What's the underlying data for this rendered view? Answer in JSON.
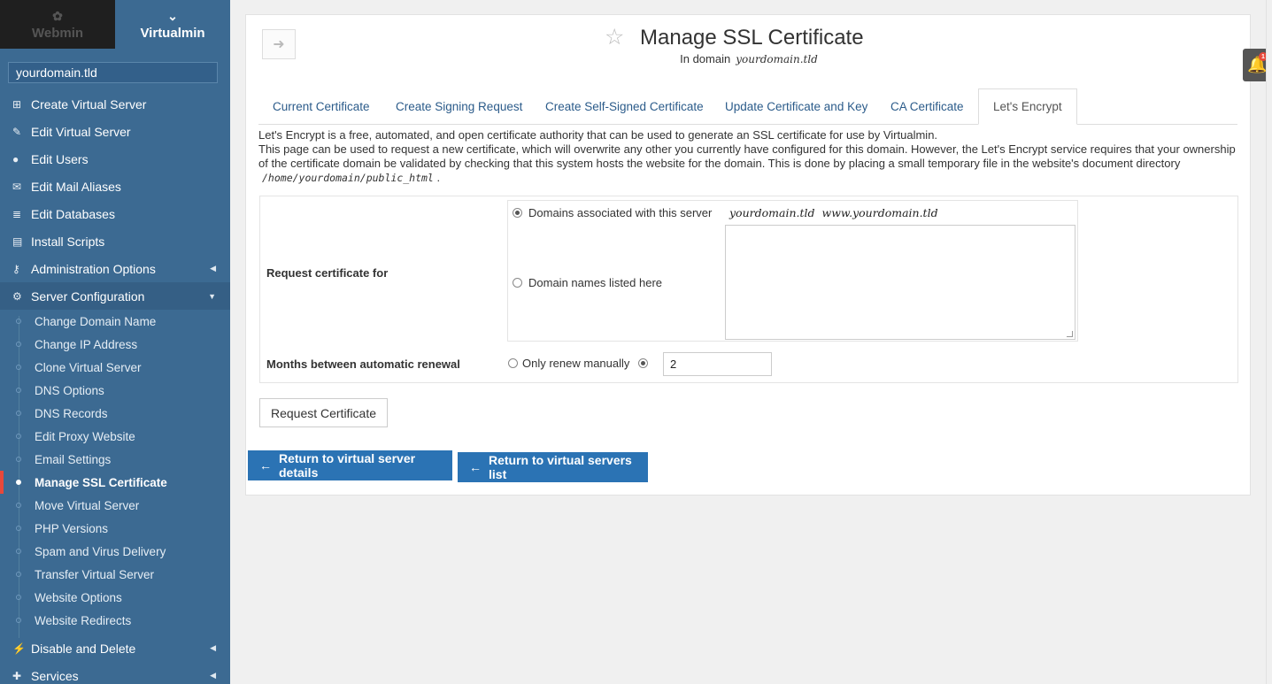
{
  "sidebar": {
    "tabs": {
      "webmin": "Webmin",
      "virtualmin": "Virtualmin"
    },
    "domain": "yourdomain.tld",
    "items": [
      {
        "label": "Create Virtual Server",
        "icon": "plus-square-icon"
      },
      {
        "label": "Edit Virtual Server",
        "icon": "edit-icon"
      },
      {
        "label": "Edit Users",
        "icon": "users-icon"
      },
      {
        "label": "Edit Mail Aliases",
        "icon": "envelope-icon"
      },
      {
        "label": "Edit Databases",
        "icon": "database-icon"
      },
      {
        "label": "Install Scripts",
        "icon": "list-icon"
      },
      {
        "label": "Administration Options",
        "icon": "key-icon"
      },
      {
        "label": "Server Configuration",
        "icon": "cogs-icon"
      }
    ],
    "subitems": [
      "Change Domain Name",
      "Change IP Address",
      "Clone Virtual Server",
      "DNS Options",
      "DNS Records",
      "Edit Proxy Website",
      "Email Settings",
      "Manage SSL Certificate",
      "Move Virtual Server",
      "PHP Versions",
      "Spam and Virus Delivery",
      "Transfer Virtual Server",
      "Website Options",
      "Website Redirects"
    ],
    "bottom_items": [
      {
        "label": "Disable and Delete",
        "icon": "plug-icon"
      },
      {
        "label": "Services",
        "icon": "puzzle-icon"
      }
    ]
  },
  "header": {
    "title": "Manage SSL Certificate",
    "subtitle_prefix": "In domain",
    "subtitle_domain": "yourdomain.tld"
  },
  "tabs": [
    "Current Certificate",
    "Create Signing Request",
    "Create Self-Signed Certificate",
    "Update Certificate and Key",
    "CA Certificate",
    "Let's Encrypt"
  ],
  "description": {
    "line1": "Let's Encrypt is a free, automated, and open certificate authority that can be used to generate an SSL certificate for use by Virtualmin.",
    "line2": "This page can be used to request a new certificate, which will overwrite any other you currently have configured for this domain. However, the Let's Encrypt service requires that your ownership",
    "line3": "of the certificate domain be validated by checking that this system hosts the website for the domain. This is done by placing a small temporary file in the website's document directory",
    "path": "/home/yourdomain/public_html",
    "period": "."
  },
  "form": {
    "request_label": "Request certificate for",
    "option_associated": "Domains associated with this server",
    "associated_domains": [
      "yourdomain.tld",
      "www.yourdomain.tld"
    ],
    "option_listed": "Domain names listed here",
    "months_label": "Months between automatic renewal",
    "option_manual": "Only renew manually",
    "months_value": "2"
  },
  "buttons": {
    "request": "Request Certificate",
    "return_details": "Return to virtual server details",
    "return_list": "Return to virtual servers list"
  },
  "notifications": {
    "count": "1"
  }
}
